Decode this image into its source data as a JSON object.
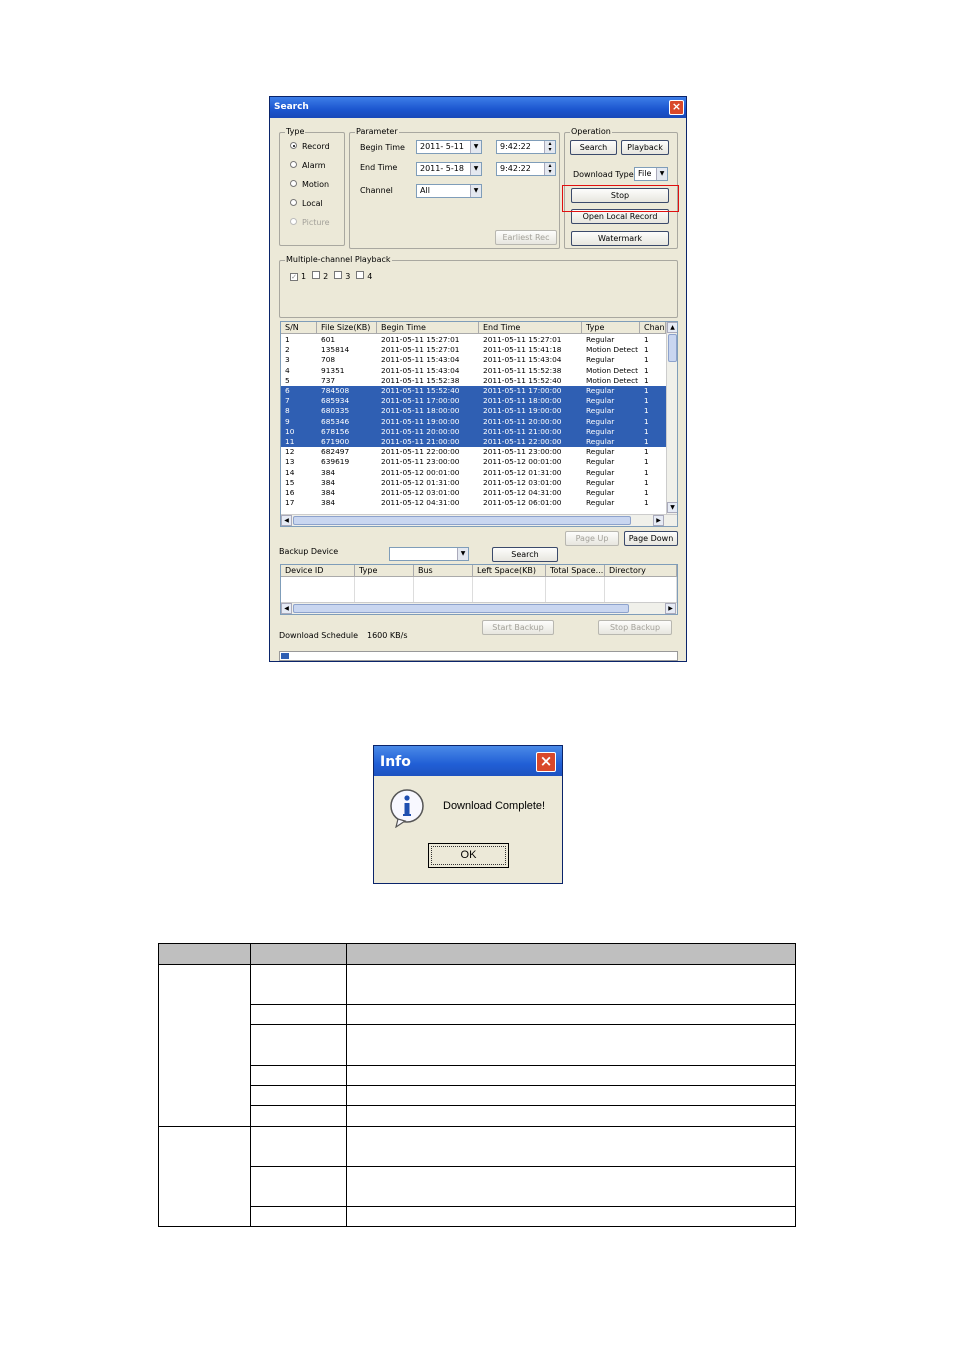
{
  "search_window": {
    "title": "Search",
    "type_group": {
      "legend": "Type",
      "options": [
        {
          "label": "Record",
          "selected": true,
          "enabled": true
        },
        {
          "label": "Alarm",
          "selected": false,
          "enabled": true
        },
        {
          "label": "Motion",
          "selected": false,
          "enabled": true
        },
        {
          "label": "Local",
          "selected": false,
          "enabled": true
        },
        {
          "label": "Picture",
          "selected": false,
          "enabled": false
        }
      ]
    },
    "parameter_group": {
      "legend": "Parameter",
      "begin_time_label": "Begin Time",
      "begin_date": "2011- 5-11",
      "begin_time": "9:42:22",
      "end_time_label": "End Time",
      "end_date": "2011- 5-18",
      "end_time": "9:42:22",
      "channel_label": "Channel",
      "channel_value": "All",
      "earliest_rec_button": "Earliest Rec"
    },
    "operation_group": {
      "legend": "Operation",
      "search_button": "Search",
      "playback_button": "Playback",
      "download_type_label": "Download Type",
      "download_type_value": "File",
      "stop_button": "Stop",
      "open_local_record_button": "Open Local Record",
      "watermark_button": "Watermark"
    },
    "multichannel": {
      "legend": "Multiple-channel Playback",
      "channels": [
        {
          "label": "1",
          "checked": true
        },
        {
          "label": "2",
          "checked": false
        },
        {
          "label": "3",
          "checked": false
        },
        {
          "label": "4",
          "checked": false
        }
      ]
    },
    "file_list": {
      "columns": [
        "S/N",
        "File Size(KB)",
        "Begin Time",
        "End Time",
        "Type",
        "Chan."
      ],
      "rows": [
        {
          "sn": "1",
          "size": "601",
          "begin": "2011-05-11 15:27:01",
          "end": "2011-05-11 15:27:01",
          "type": "Regular",
          "chan": "1",
          "selected": false
        },
        {
          "sn": "2",
          "size": "135814",
          "begin": "2011-05-11 15:27:01",
          "end": "2011-05-11 15:41:18",
          "type": "Motion Detect",
          "chan": "1",
          "selected": false
        },
        {
          "sn": "3",
          "size": "708",
          "begin": "2011-05-11 15:43:04",
          "end": "2011-05-11 15:43:04",
          "type": "Regular",
          "chan": "1",
          "selected": false
        },
        {
          "sn": "4",
          "size": "91351",
          "begin": "2011-05-11 15:43:04",
          "end": "2011-05-11 15:52:38",
          "type": "Motion Detect",
          "chan": "1",
          "selected": false
        },
        {
          "sn": "5",
          "size": "737",
          "begin": "2011-05-11 15:52:38",
          "end": "2011-05-11 15:52:40",
          "type": "Motion Detect",
          "chan": "1",
          "selected": false
        },
        {
          "sn": "6",
          "size": "784508",
          "begin": "2011-05-11 15:52:40",
          "end": "2011-05-11 17:00:00",
          "type": "Regular",
          "chan": "1",
          "selected": true
        },
        {
          "sn": "7",
          "size": "685934",
          "begin": "2011-05-11 17:00:00",
          "end": "2011-05-11 18:00:00",
          "type": "Regular",
          "chan": "1",
          "selected": true
        },
        {
          "sn": "8",
          "size": "680335",
          "begin": "2011-05-11 18:00:00",
          "end": "2011-05-11 19:00:00",
          "type": "Regular",
          "chan": "1",
          "selected": true
        },
        {
          "sn": "9",
          "size": "685346",
          "begin": "2011-05-11 19:00:00",
          "end": "2011-05-11 20:00:00",
          "type": "Regular",
          "chan": "1",
          "selected": true
        },
        {
          "sn": "10",
          "size": "678156",
          "begin": "2011-05-11 20:00:00",
          "end": "2011-05-11 21:00:00",
          "type": "Regular",
          "chan": "1",
          "selected": true
        },
        {
          "sn": "11",
          "size": "671900",
          "begin": "2011-05-11 21:00:00",
          "end": "2011-05-11 22:00:00",
          "type": "Regular",
          "chan": "1",
          "selected": true
        },
        {
          "sn": "12",
          "size": "682497",
          "begin": "2011-05-11 22:00:00",
          "end": "2011-05-11 23:00:00",
          "type": "Regular",
          "chan": "1",
          "selected": false
        },
        {
          "sn": "13",
          "size": "639619",
          "begin": "2011-05-11 23:00:00",
          "end": "2011-05-12 00:01:00",
          "type": "Regular",
          "chan": "1",
          "selected": false
        },
        {
          "sn": "14",
          "size": "384",
          "begin": "2011-05-12 00:01:00",
          "end": "2011-05-12 01:31:00",
          "type": "Regular",
          "chan": "1",
          "selected": false
        },
        {
          "sn": "15",
          "size": "384",
          "begin": "2011-05-12 01:31:00",
          "end": "2011-05-12 03:01:00",
          "type": "Regular",
          "chan": "1",
          "selected": false
        },
        {
          "sn": "16",
          "size": "384",
          "begin": "2011-05-12 03:01:00",
          "end": "2011-05-12 04:31:00",
          "type": "Regular",
          "chan": "1",
          "selected": false
        },
        {
          "sn": "17",
          "size": "384",
          "begin": "2011-05-12 04:31:00",
          "end": "2011-05-12 06:01:00",
          "type": "Regular",
          "chan": "1",
          "selected": false
        }
      ]
    },
    "page_up_button": "Page Up",
    "page_down_button": "Page Down",
    "backup_device_label": "Backup Device",
    "backup_search_button": "Search",
    "backup_list_columns": [
      "Device ID",
      "Type",
      "Bus",
      "Left Space(KB)",
      "Total Space...",
      "Directory"
    ],
    "start_backup_button": "Start Backup",
    "stop_backup_button": "Stop Backup",
    "download_schedule_label": "Download Schedule",
    "download_speed": "1600 KB/s",
    "download_progress": 0.02
  },
  "info_dialog": {
    "title": "Info",
    "message": "Download Complete!",
    "ok_button": "OK"
  },
  "colors": {
    "title_bar": "#1b55cf",
    "selection": "#2f5fb3",
    "highlight": "#e01010",
    "window_bg": "#ece9d8"
  }
}
